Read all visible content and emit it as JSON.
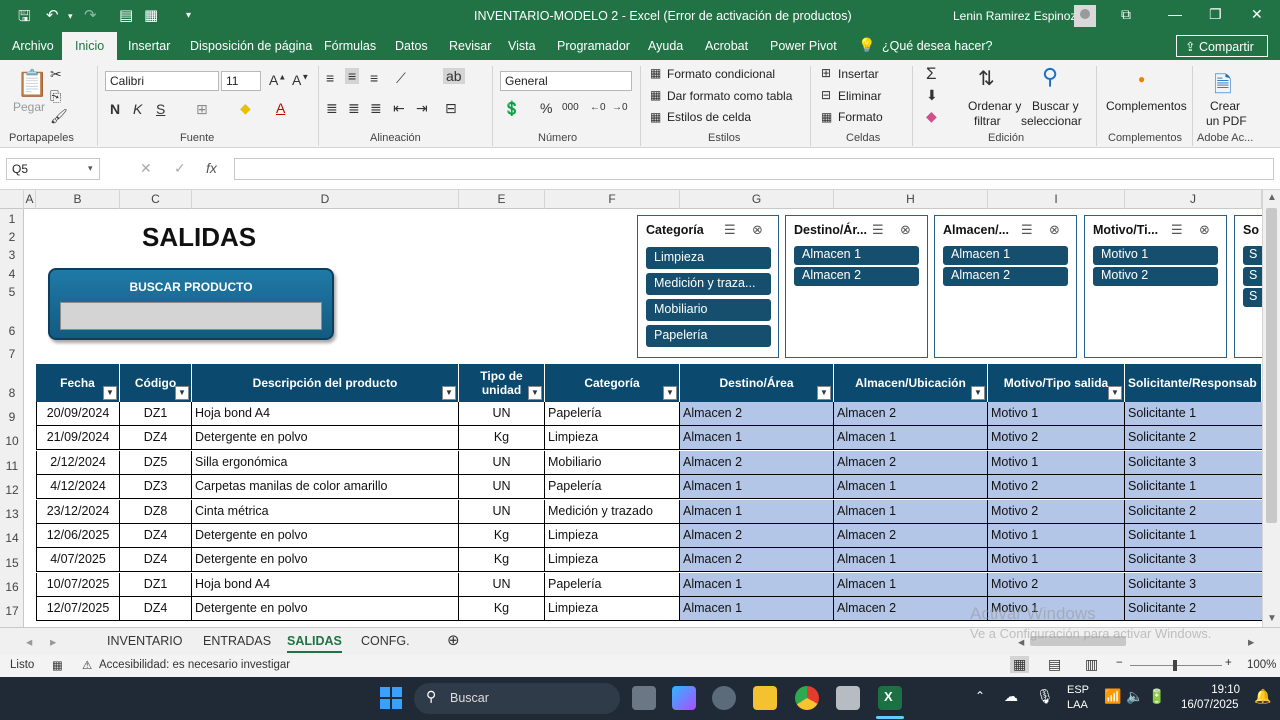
{
  "window": {
    "title": "INVENTARIO-MODELO 2  -  Excel (Error de activación de productos)",
    "user": "Lenin Ramirez Espinoza"
  },
  "menu": {
    "tabs": [
      "Archivo",
      "Inicio",
      "Insertar",
      "Disposición de página",
      "Fórmulas",
      "Datos",
      "Revisar",
      "Vista",
      "Programador",
      "Ayuda",
      "Acrobat",
      "Power Pivot"
    ],
    "search": "¿Qué desea hacer?",
    "share": "Compartir"
  },
  "ribbon": {
    "paste": "Pegar",
    "portapapeles": "Portapapeles",
    "font_name": "Calibri",
    "font_size": "11",
    "fuente": "Fuente",
    "alineacion": "Alineación",
    "number_format": "General",
    "numero": "Número",
    "conditional": "Formato condicional",
    "as_table": "Dar formato como tabla",
    "cell_styles": "Estilos de celda",
    "estilos": "Estilos",
    "insert": "Insertar",
    "delete": "Eliminar",
    "format": "Formato",
    "celdas": "Celdas",
    "sort": "Ordenar y",
    "sort2": "filtrar",
    "find": "Buscar y",
    "find2": "seleccionar",
    "edicion": "Edición",
    "addins": "Complementos",
    "addins_group": "Complementos",
    "pdf": "Crear",
    "pdf2": "un PDF",
    "adobe": "Adobe Ac..."
  },
  "formula": {
    "namebox": "Q5",
    "fx": "fx"
  },
  "columns": [
    "A",
    "B",
    "C",
    "D",
    "E",
    "F",
    "G",
    "H",
    "I",
    "J"
  ],
  "rows": [
    "1",
    "2",
    "3",
    "4",
    "5",
    "6",
    "7",
    "8",
    "9",
    "10",
    "11",
    "12",
    "13",
    "14",
    "15",
    "16",
    "17"
  ],
  "sheet": {
    "title": "SALIDAS",
    "search_label": "BUSCAR PRODUCTO"
  },
  "slicers": [
    {
      "header": "Categoría",
      "items": [
        "Limpieza",
        "Medición y traza...",
        "Mobiliario",
        "Papelería"
      ]
    },
    {
      "header": "Destino/Ár...",
      "items": [
        "Almacen 1",
        "Almacen 2"
      ]
    },
    {
      "header": "Almacen/...",
      "items": [
        "Almacen 1",
        "Almacen 2"
      ]
    },
    {
      "header": "Motivo/Ti...",
      "items": [
        "Motivo 1",
        "Motivo 2"
      ]
    },
    {
      "header": "So",
      "items": [
        "S",
        "S",
        "S"
      ]
    }
  ],
  "table": {
    "headers": [
      "Fecha",
      "Código",
      "Descripción del producto",
      "Tipo de unidad",
      "Categoría",
      "Destino/Área",
      "Almacen/Ubicación",
      "Motivo/Tipo salida",
      "Solicitante/Responsab"
    ],
    "rows": [
      [
        "20/09/2024",
        "DZ1",
        "Hoja bond A4",
        "UN",
        "Papelería",
        "Almacen 2",
        "Almacen 2",
        "Motivo 1",
        "Solicitante 1"
      ],
      [
        "21/09/2024",
        "DZ4",
        "Detergente en polvo",
        "Kg",
        "Limpieza",
        "Almacen 1",
        "Almacen 1",
        "Motivo 2",
        "Solicitante 2"
      ],
      [
        "2/12/2024",
        "DZ5",
        "Silla ergonómica",
        "UN",
        "Mobiliario",
        "Almacen 2",
        "Almacen 2",
        "Motivo 1",
        "Solicitante 3"
      ],
      [
        "4/12/2024",
        "DZ3",
        "Carpetas manilas de color amarillo",
        "UN",
        "Papelería",
        "Almacen 1",
        "Almacen 1",
        "Motivo 2",
        "Solicitante 1"
      ],
      [
        "23/12/2024",
        "DZ8",
        "Cinta métrica",
        "UN",
        "Medición y trazado",
        "Almacen 1",
        "Almacen 1",
        "Motivo 2",
        "Solicitante 2"
      ],
      [
        "12/06/2025",
        "DZ4",
        "Detergente en polvo",
        "Kg",
        "Limpieza",
        "Almacen 2",
        "Almacen 2",
        "Motivo 1",
        "Solicitante 1"
      ],
      [
        "4/07/2025",
        "DZ4",
        "Detergente en polvo",
        "Kg",
        "Limpieza",
        "Almacen 2",
        "Almacen 1",
        "Motivo 1",
        "Solicitante 3"
      ],
      [
        "10/07/2025",
        "DZ1",
        "Hoja bond A4",
        "UN",
        "Papelería",
        "Almacen 1",
        "Almacen 1",
        "Motivo 2",
        "Solicitante 3"
      ],
      [
        "12/07/2025",
        "DZ4",
        "Detergente en polvo",
        "Kg",
        "Limpieza",
        "Almacen 1",
        "Almacen 2",
        "Motivo 1",
        "Solicitante 2"
      ]
    ]
  },
  "sheet_tabs": [
    "INVENTARIO",
    "ENTRADAS",
    "SALIDAS",
    "CONFG."
  ],
  "status": {
    "ready": "Listo",
    "accessibility": "Accesibilidad: es necesario investigar",
    "zoom": "100%"
  },
  "watermark": {
    "line1": "Activar Windows",
    "line2": "Ve a Configuración para activar Windows."
  },
  "taskbar": {
    "search": "Buscar",
    "lang1": "ESP",
    "lang2": "LAA",
    "time": "19:10",
    "date": "16/07/2025"
  },
  "colors": {
    "excel_green": "#217346",
    "table_header": "#0b4a6e",
    "slicer_item": "#164f6d",
    "table_blue": "#b4c6e7"
  }
}
